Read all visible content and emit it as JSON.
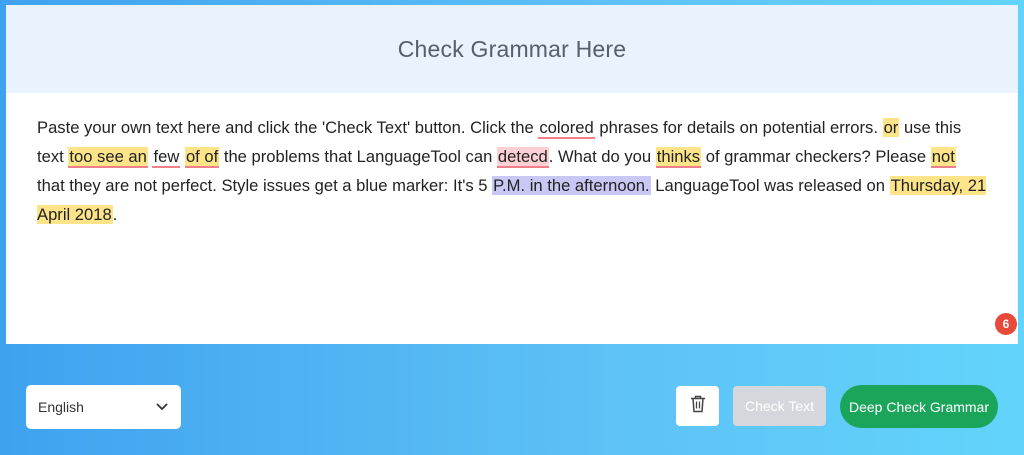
{
  "header": {
    "title": "Check Grammar Here"
  },
  "editor": {
    "t1": "Paste your own text here and click the 'Check Text' button. Click the ",
    "m1": "colored",
    "t2": " phrases for details on potential errors. ",
    "m2": "or",
    "t3": " use this text ",
    "m3": "too see an",
    "t4": " ",
    "m4": "few",
    "t5": " ",
    "m5": "of of",
    "t6": " the problems that LanguageTool can ",
    "m6": "detecd",
    "t7": ". What do you ",
    "m7": "thinks",
    "t8": " of grammar checkers? Please ",
    "m8": "not",
    "t9": " that they are not perfect. Style issues get a blue marker: It's 5 ",
    "m9": "P.M. in the afternoon.",
    "t10": " LanguageTool was released on ",
    "m10": "Thursday, 21 April 2018",
    "t11": "."
  },
  "error_count": "6",
  "footer": {
    "language": "English",
    "check_label": "Check Text",
    "deep_label": "Deep Check Grammar"
  },
  "icons": [
    "chevron-down-icon",
    "trash-icon"
  ],
  "colors": {
    "grammar_highlight": "#fde489",
    "spelling_underline": "#f07f8a",
    "style_highlight": "#c9c8f4",
    "deep_button": "#1aa55b",
    "badge": "#e8493a"
  }
}
